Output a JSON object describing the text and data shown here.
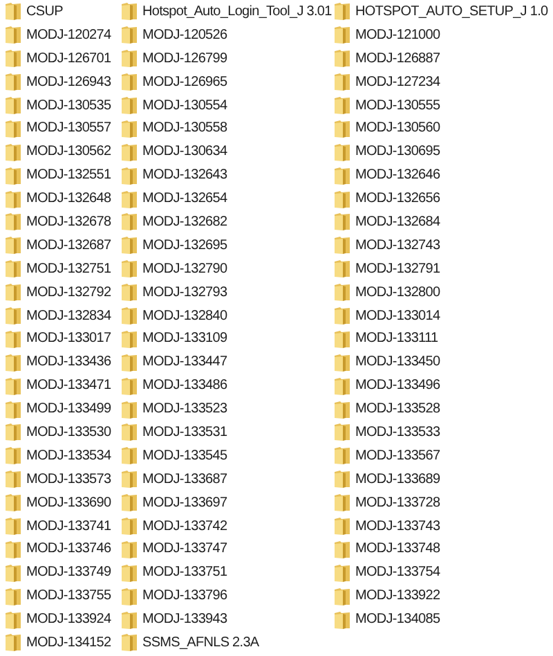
{
  "items": [
    "CSUP",
    "Hotspot_Auto_Login_Tool_J 3.01",
    "HOTSPOT_AUTO_SETUP_J 1.0",
    "MODJ-120274",
    "MODJ-120526",
    "MODJ-121000",
    "MODJ-126701",
    "MODJ-126799",
    "MODJ-126887",
    "MODJ-126943",
    "MODJ-126965",
    "MODJ-127234",
    "MODJ-130535",
    "MODJ-130554",
    "MODJ-130555",
    "MODJ-130557",
    "MODJ-130558",
    "MODJ-130560",
    "MODJ-130562",
    "MODJ-130634",
    "MODJ-130695",
    "MODJ-132551",
    "MODJ-132643",
    "MODJ-132646",
    "MODJ-132648",
    "MODJ-132654",
    "MODJ-132656",
    "MODJ-132678",
    "MODJ-132682",
    "MODJ-132684",
    "MODJ-132687",
    "MODJ-132695",
    "MODJ-132743",
    "MODJ-132751",
    "MODJ-132790",
    "MODJ-132791",
    "MODJ-132792",
    "MODJ-132793",
    "MODJ-132800",
    "MODJ-132834",
    "MODJ-132840",
    "MODJ-133014",
    "MODJ-133017",
    "MODJ-133109",
    "MODJ-133111",
    "MODJ-133436",
    "MODJ-133447",
    "MODJ-133450",
    "MODJ-133471",
    "MODJ-133486",
    "MODJ-133496",
    "MODJ-133499",
    "MODJ-133523",
    "MODJ-133528",
    "MODJ-133530",
    "MODJ-133531",
    "MODJ-133533",
    "MODJ-133534",
    "MODJ-133545",
    "MODJ-133567",
    "MODJ-133573",
    "MODJ-133687",
    "MODJ-133689",
    "MODJ-133690",
    "MODJ-133697",
    "MODJ-133728",
    "MODJ-133741",
    "MODJ-133742",
    "MODJ-133743",
    "MODJ-133746",
    "MODJ-133747",
    "MODJ-133748",
    "MODJ-133749",
    "MODJ-133751",
    "MODJ-133754",
    "MODJ-133755",
    "MODJ-133796",
    "MODJ-133922",
    "MODJ-133924",
    "MODJ-133943",
    "MODJ-134085",
    "MODJ-134152",
    "SSMS_AFNLS 2.3A"
  ]
}
